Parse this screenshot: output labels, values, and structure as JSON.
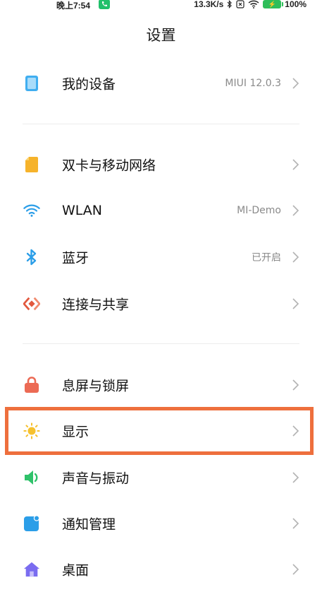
{
  "status_bar": {
    "time": "晚上7:54",
    "call_icon": "phone-icon",
    "net_speed": "13.3K/s",
    "battery": "100%",
    "battery_text": "100%",
    "accent": "#20c06a"
  },
  "page": {
    "title": "设置"
  },
  "settings": {
    "my_device": {
      "label": "我的设备",
      "value": "MIUI 12.0.3",
      "icon": "device-icon"
    },
    "sim": {
      "label": "双卡与移动网络",
      "icon": "sim-card-icon"
    },
    "wlan": {
      "label": "WLAN",
      "value": "MI-Demo",
      "icon": "wifi-icon"
    },
    "bluetooth": {
      "label": "蓝牙",
      "value": "已开启",
      "icon": "bluetooth-icon"
    },
    "share": {
      "label": "连接与共享",
      "icon": "share-icon"
    },
    "lock": {
      "label": "息屏与锁屏",
      "icon": "lock-icon"
    },
    "display": {
      "label": "显示",
      "icon": "sun-icon"
    },
    "sound": {
      "label": "声音与振动",
      "icon": "speaker-icon"
    },
    "notify": {
      "label": "通知管理",
      "icon": "notification-icon"
    },
    "desktop": {
      "label": "桌面",
      "icon": "home-icon"
    }
  },
  "highlight_color": "#ee6f3d"
}
